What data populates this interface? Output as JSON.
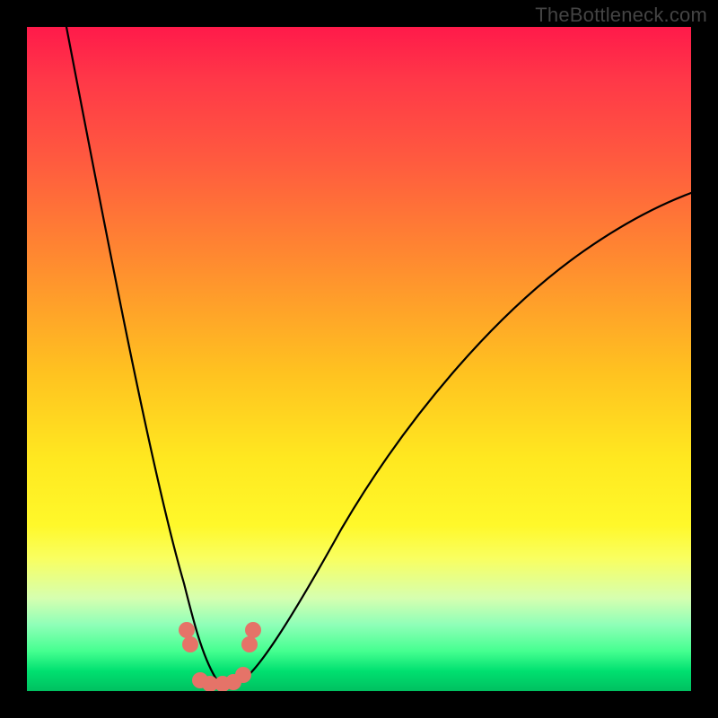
{
  "watermark": "TheBottleneck.com",
  "colors": {
    "background": "#000000",
    "gradient_top": "#ff1a4a",
    "gradient_bottom": "#00c060",
    "curve": "#000000",
    "marker": "#e57368"
  },
  "chart_data": {
    "type": "line",
    "title": "",
    "xlabel": "",
    "ylabel": "",
    "xlim": [
      0,
      100
    ],
    "ylim": [
      0,
      100
    ],
    "series": [
      {
        "name": "bottleneck-curve",
        "x": [
          6,
          10,
          15,
          20,
          24,
          26,
          28,
          30,
          33,
          40,
          50,
          60,
          70,
          80,
          90,
          100
        ],
        "y": [
          100,
          70,
          40,
          18,
          6,
          2,
          0,
          0,
          2,
          10,
          25,
          40,
          53,
          63,
          71,
          77
        ]
      }
    ],
    "markers": {
      "name": "highlight-dots",
      "points": [
        {
          "x": 24.0,
          "y": 9.0
        },
        {
          "x": 24.5,
          "y": 7.0
        },
        {
          "x": 26.0,
          "y": 1.5
        },
        {
          "x": 27.5,
          "y": 1.0
        },
        {
          "x": 29.5,
          "y": 1.0
        },
        {
          "x": 31.0,
          "y": 1.3
        },
        {
          "x": 32.5,
          "y": 2.5
        },
        {
          "x": 33.5,
          "y": 7.0
        },
        {
          "x": 34.0,
          "y": 9.0
        }
      ]
    }
  }
}
